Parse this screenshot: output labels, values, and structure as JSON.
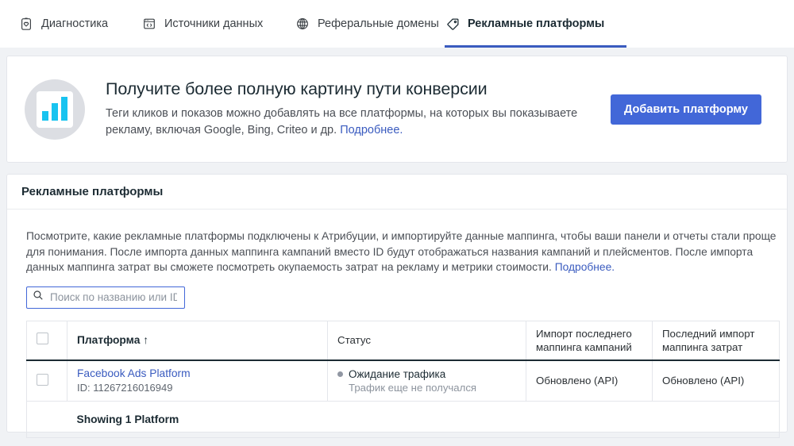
{
  "tabs": [
    {
      "label": "Диагностика",
      "icon": "clipboard-check-icon",
      "active": false
    },
    {
      "label": "Источники данных",
      "icon": "code-window-icon",
      "active": false
    },
    {
      "label": "Реферальные домены",
      "icon": "globe-icon",
      "active": false
    },
    {
      "label": "Рекламные платформы",
      "icon": "tag-icon",
      "active": true
    }
  ],
  "hero": {
    "icon": "bar-chart-icon",
    "title": "Получите более полную картину пути конверсии",
    "subtitle": "Теги кликов и показов можно добавлять на все платформы, на которых вы показываете рекламу, включая Google, Bing, Criteo и др. ",
    "subtitle_link": "Подробнее.",
    "button_label": "Добавить платформу"
  },
  "card": {
    "title": "Рекламные платформы",
    "description": "Посмотрите, какие рекламные платформы подключены к Атрибуции, и импортируйте данные маппинга, чтобы ваши панели и отчеты стали проще для понимания. После импорта данных маппинга кампаний вместо ID будут отображаться названия кампаний и плейсментов. После импорта данных маппинга затрат вы сможете посмотреть окупаемость затрат на рекламу и метрики стоимости. ",
    "description_link": "Подробнее."
  },
  "search": {
    "placeholder": "Поиск по названию или ID",
    "value": "",
    "icon": "search-icon"
  },
  "table": {
    "columns": [
      {
        "label": "",
        "key": "checkbox"
      },
      {
        "label": "Платформа",
        "key": "platform",
        "sort": "↑",
        "sorted": true
      },
      {
        "label": "Статус",
        "key": "status"
      },
      {
        "label": "Импорт последнего маппинга кампаний",
        "key": "campaign_import"
      },
      {
        "label": "Последний импорт маппинга затрат",
        "key": "cost_import"
      }
    ],
    "rows": [
      {
        "platform_name": "Facebook Ads Platform",
        "platform_id": "ID: 11267216016949",
        "status_title": "Ожидание трафика",
        "status_sub": "Трафик еще не получался",
        "status_dot_color": "#9197a3",
        "campaign_import": "Обновлено (API)",
        "cost_import": "Обновлено (API)"
      }
    ],
    "footer": "Showing 1 Platform"
  },
  "colors": {
    "accent": "#4267d8",
    "link": "#3a5bbf",
    "chart_cyan": "#18c3f0",
    "page_bg": "#f0f2f5"
  }
}
